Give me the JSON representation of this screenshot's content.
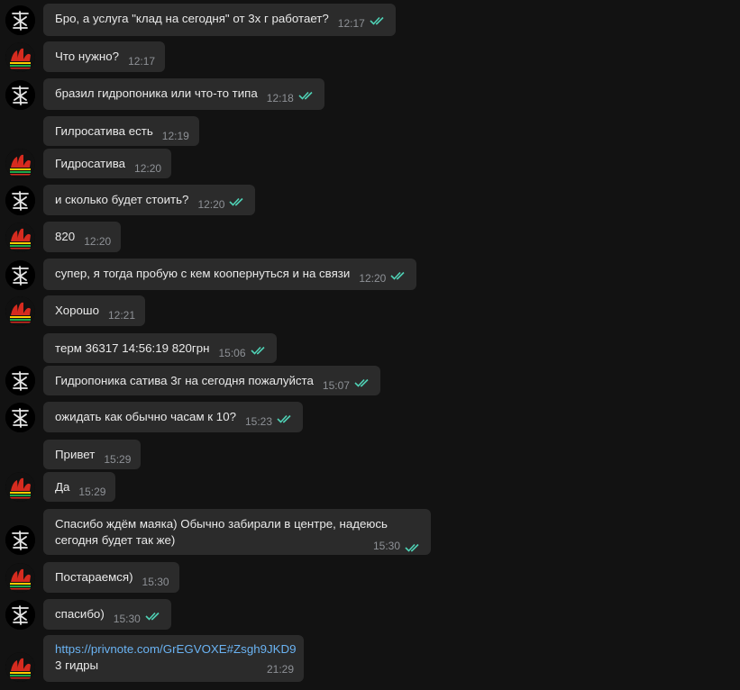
{
  "colors": {
    "background": "#121212",
    "bubble": "#2b2b2b",
    "time": "#8e9196",
    "read_ticks": "#4fd1b5",
    "link": "#6ab3f3"
  },
  "messages": [
    {
      "sender": "me",
      "text": "Бро, а услуга \"клад на сегодня\" от 3х г работает?",
      "time": "12:17",
      "read": true
    },
    {
      "sender": "them",
      "text": "Что нужно?",
      "time": "12:17",
      "read": false
    },
    {
      "sender": "me",
      "text": "бразил гидропоника или что-то типа",
      "time": "12:18",
      "read": true
    },
    {
      "sender": "them",
      "text": "Гилросатива есть",
      "time": "12:19",
      "read": false
    },
    {
      "sender": "them",
      "text": "Гидросатива",
      "time": "12:20",
      "read": false
    },
    {
      "sender": "me",
      "text": "и сколько будет стоить?",
      "time": "12:20",
      "read": true
    },
    {
      "sender": "them",
      "text": "820",
      "time": "12:20",
      "read": false
    },
    {
      "sender": "me",
      "text": "супер, я тогда пробую с кем коопернуться и на связи",
      "time": "12:20",
      "read": true
    },
    {
      "sender": "them",
      "text": "Хорошо",
      "time": "12:21",
      "read": false
    },
    {
      "sender": "me",
      "text": "терм 36317 14:56:19 820грн",
      "time": "15:06",
      "read": true
    },
    {
      "sender": "me",
      "text": "Гидропоника сатива 3г на сегодня пожалуйста",
      "time": "15:07",
      "read": true
    },
    {
      "sender": "me",
      "text": "ожидать как обычно часам к 10?",
      "time": "15:23",
      "read": true
    },
    {
      "sender": "them",
      "text": "Привет",
      "time": "15:29",
      "read": false
    },
    {
      "sender": "them",
      "text": "Да",
      "time": "15:29",
      "read": false
    },
    {
      "sender": "me",
      "text_line1": "Спасибо ждём маяка) Обычно забирали в центре, надеюсь",
      "text_line2": "сегодня будет так же)",
      "time": "15:30",
      "read": true
    },
    {
      "sender": "them",
      "text": "Постараемся)",
      "time": "15:30",
      "read": false
    },
    {
      "sender": "me",
      "text": "спасибо)",
      "time": "15:30",
      "read": true
    },
    {
      "sender": "them",
      "link": "https://privnote.com/GrEGVOXE#Zsgh9JKD9",
      "text": "3 гидры",
      "time": "21:29",
      "read": false
    }
  ]
}
